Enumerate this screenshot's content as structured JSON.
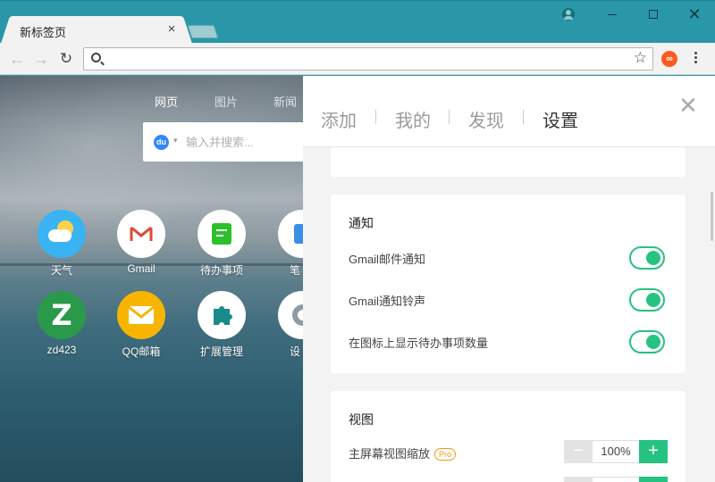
{
  "tab": {
    "title": "新标签页",
    "close": "×"
  },
  "window": {
    "close": "✕"
  },
  "toolbar": {
    "back": "←",
    "forward": "→",
    "reload": "↻",
    "star": "☆",
    "extension": "∞",
    "address_value": "",
    "address_placeholder": ""
  },
  "search": {
    "tabs": [
      "网页",
      "图片",
      "新闻"
    ],
    "engine_icon": "du",
    "caret": "▾",
    "placeholder": "输入并搜索..."
  },
  "apps": [
    {
      "label": "天气",
      "icon": "weather-icon",
      "color": "#3ab3f2"
    },
    {
      "label": "Gmail",
      "icon": "gmail-icon",
      "color": "#ffffff"
    },
    {
      "label": "待办事项",
      "icon": "todo-icon",
      "color": "#ffffff"
    },
    {
      "label": "笔",
      "icon": "notes-icon",
      "color": "#ffffff"
    },
    {
      "label": "zd423",
      "icon": "zd423-icon",
      "color": "#2a9a4a"
    },
    {
      "label": "QQ邮箱",
      "icon": "qqmail-icon",
      "color": "#f7b500"
    },
    {
      "label": "扩展管理",
      "icon": "puzzle-icon",
      "color": "#ffffff"
    },
    {
      "label": "设",
      "icon": "gear-icon",
      "color": "#ffffff"
    }
  ],
  "panel": {
    "tabs": [
      "添加",
      "我的",
      "发现",
      "设置"
    ],
    "active_tab": "设置",
    "close": "╳",
    "notifications": {
      "title": "通知",
      "items": [
        {
          "label": "Gmail邮件通知",
          "enabled": true
        },
        {
          "label": "Gmail通知铃声",
          "enabled": true
        },
        {
          "label": "在图标上显示待办事项数量",
          "enabled": true
        }
      ]
    },
    "view": {
      "title": "视图",
      "zoom_label": "主屏幕视图缩放",
      "pro_badge": "Pro",
      "zoom_value": "100%",
      "minus": "−",
      "plus": "+"
    }
  },
  "colors": {
    "accent": "#26c282",
    "titlebar": "#2a97a9"
  }
}
